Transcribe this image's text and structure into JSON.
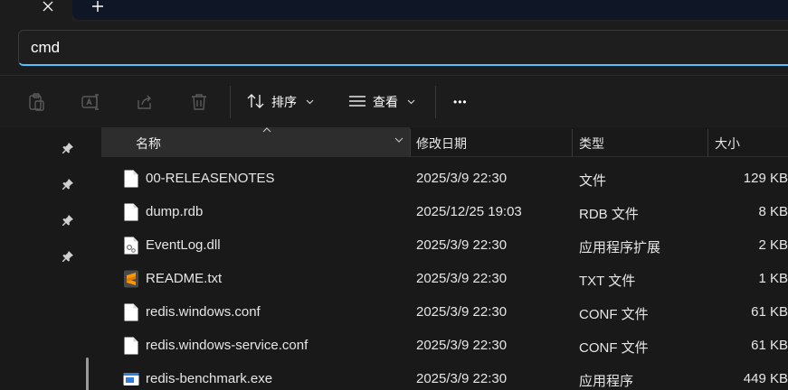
{
  "tabbar": {
    "close_glyph": "✕",
    "newtab_glyph": "+"
  },
  "address": {
    "value": "cmd"
  },
  "toolbar": {
    "sort_label": "排序",
    "view_label": "查看",
    "more_glyph": "•••"
  },
  "columns": {
    "name": "名称",
    "date": "修改日期",
    "type": "类型",
    "size": "大小"
  },
  "files": [
    {
      "name": "00-RELEASENOTES",
      "date": "2025/3/9 22:30",
      "type": "文件",
      "size": "129 KB",
      "icon": "document-icon"
    },
    {
      "name": "dump.rdb",
      "date": "2025/12/25 19:03",
      "type": "RDB 文件",
      "size": "8 KB",
      "icon": "document-icon"
    },
    {
      "name": "EventLog.dll",
      "date": "2025/3/9 22:30",
      "type": "应用程序扩展",
      "size": "2 KB",
      "icon": "dll-icon"
    },
    {
      "name": "README.txt",
      "date": "2025/3/9 22:30",
      "type": "TXT 文件",
      "size": "1 KB",
      "icon": "sublime-icon"
    },
    {
      "name": "redis.windows.conf",
      "date": "2025/3/9 22:30",
      "type": "CONF 文件",
      "size": "61 KB",
      "icon": "document-icon"
    },
    {
      "name": "redis.windows-service.conf",
      "date": "2025/3/9 22:30",
      "type": "CONF 文件",
      "size": "61 KB",
      "icon": "document-icon"
    },
    {
      "name": "redis-benchmark.exe",
      "date": "2025/3/9 22:30",
      "type": "应用程序",
      "size": "449 KB",
      "icon": "exe-icon"
    }
  ],
  "colors": {
    "accent": "#4cc2ff",
    "background": "#191919",
    "header_active": "#2d2d2d"
  }
}
